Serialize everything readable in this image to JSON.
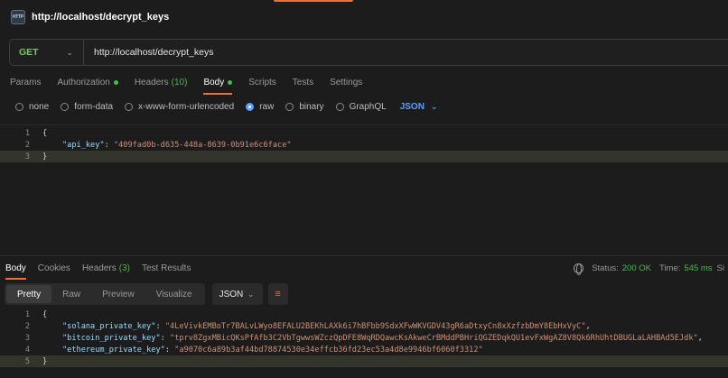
{
  "header": {
    "icon_text": "HTTP",
    "title": "http://localhost/decrypt_keys"
  },
  "request": {
    "method": "GET",
    "url": "http://localhost/decrypt_keys",
    "tabs": [
      {
        "label": "Params"
      },
      {
        "label": "Authorization"
      },
      {
        "label": "Headers",
        "count": "(10)"
      },
      {
        "label": "Body"
      },
      {
        "label": "Scripts"
      },
      {
        "label": "Tests"
      },
      {
        "label": "Settings"
      }
    ],
    "body_modes": [
      "none",
      "form-data",
      "x-www-form-urlencoded",
      "raw",
      "binary",
      "GraphQL"
    ],
    "selected_mode": "raw",
    "format": "JSON",
    "line_numbers": [
      "1",
      "2",
      "3"
    ],
    "code": {
      "open": "{",
      "key": "\"api_key\"",
      "colon": ": ",
      "value": "\"409fad0b-d635-448a-8639-0b91e6c6face\"",
      "close": "}"
    }
  },
  "response": {
    "tabs": [
      {
        "label": "Body"
      },
      {
        "label": "Cookies"
      },
      {
        "label": "Headers",
        "count": "(3)"
      },
      {
        "label": "Test Results"
      }
    ],
    "status_label": "Status:",
    "status_value": "200 OK",
    "time_label": "Time:",
    "time_value": "545 ms",
    "size_label": "Si",
    "views": [
      "Pretty",
      "Raw",
      "Preview",
      "Visualize"
    ],
    "active_view": "Pretty",
    "format": "JSON",
    "line_numbers": [
      "1",
      "2",
      "3",
      "4",
      "5"
    ],
    "lines": [
      {
        "key": "\"solana_private_key\"",
        "value": "\"4LeVivkEMBoTr7BALvLWyo8EFALU2BEKhLAXk6i7hBFbb9SdxXFwWKVGDV43gR6aDtxyCn8xXzfzbDmY8EbHxVyC\"",
        "trail": ","
      },
      {
        "key": "\"bitcoin_private_key\"",
        "value": "\"tprv8ZgxMBicQKsPfAfb3C2VbTgwwsWZczQpDFE8WqRDQawcKsAkweCrBMddPBHriQGZEDqkQU1evFxWgAZ8V8Qk6RhUhtDBUGLaLAHBAd5EJdk\"",
        "trail": ","
      },
      {
        "key": "\"ethereum_private_key\"",
        "value": "\"a9070c6a89b3af44bd78874530e34effcb36fd23ec53a4d8e9946bf6060f3312\"",
        "trail": ""
      }
    ],
    "open": "{",
    "close": "}"
  },
  "colors": {
    "accent": "#e8713c",
    "method_get": "#7ec56b",
    "status_ok": "#4bb84b",
    "json_key": "#9cdcfe",
    "json_string": "#ce9178",
    "link_blue": "#5aa0ff"
  }
}
